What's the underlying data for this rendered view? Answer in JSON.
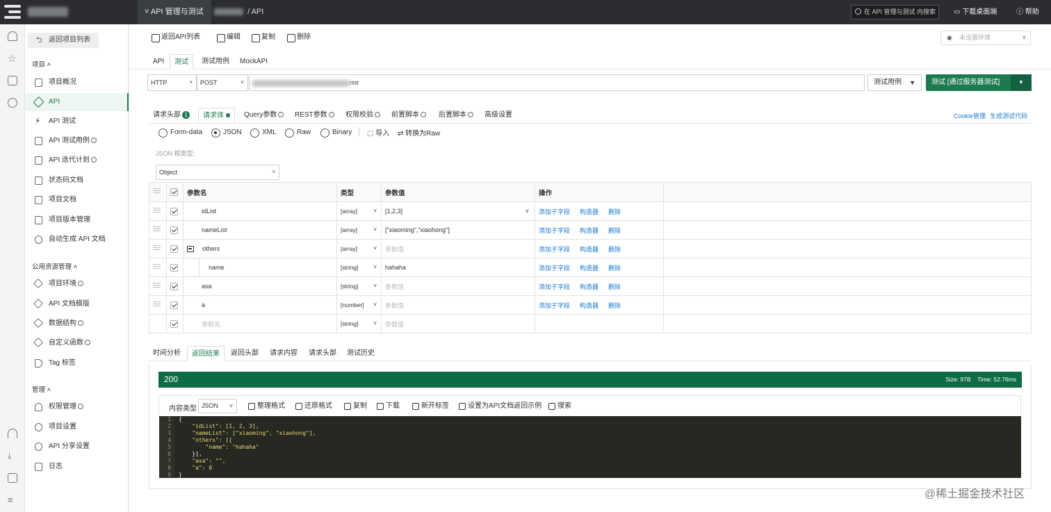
{
  "topbar": {
    "menu_label": "API 管理与测试",
    "crumb_tail": "/ API",
    "search_placeholder": "在 API 管理与测试 内搜索",
    "download_label": "下载桌面端",
    "help_label": "帮助"
  },
  "sidebar": {
    "back_label": "返回项目列表",
    "section_project": "项目 ˄",
    "project_items": [
      "项目概况",
      "API",
      "API 测试",
      "API 测试用例",
      "API 迭代计划",
      "状态码文档",
      "项目文档",
      "项目版本管理",
      "自动生成 API 文档"
    ],
    "section_public": "公用资源管理 ˄",
    "public_items": [
      "项目环境",
      "API 文档模版",
      "数据结构",
      "自定义函数",
      "Tag 标签"
    ],
    "section_manage": "管理 ˄",
    "manage_items": [
      "权限管理",
      "项目设置",
      "API 分享设置",
      "日志"
    ]
  },
  "toolbar": {
    "back_label": "返回API列表",
    "edit_label": "编辑",
    "copy_label": "复制",
    "delete_label": "删除",
    "env_placeholder": "未设置环境"
  },
  "main_tabs": [
    "API",
    "测试",
    "测试用例",
    "MockAPI"
  ],
  "request": {
    "protocol": "HTTP",
    "method": "POST",
    "url_suffix": "rint",
    "case_label": "测试用例",
    "send_label": "测试 [通过服务器测试]"
  },
  "req_tabs": {
    "headers": "请求头部",
    "headers_count": "1",
    "body": "请求体",
    "query": "Query参数",
    "rest": "REST参数",
    "auth": "权限校验",
    "pre": "前置脚本",
    "post": "后置脚本",
    "advanced": "高级设置",
    "cookie": "Cookie管理",
    "gen_code": "生成测试代码"
  },
  "body_types": [
    "Form-data",
    "JSON",
    "XML",
    "Raw",
    "Binary"
  ],
  "body_actions": {
    "import": "导入",
    "to_raw": "转换为Raw"
  },
  "json_root_label": "JSON 根类型:",
  "json_root_value": "Object",
  "params": {
    "headers": {
      "name": "参数名",
      "type": "类型",
      "value": "参数值",
      "ops": "操作"
    },
    "ops": {
      "add_child": "添加子字段",
      "builder": "构造器",
      "delete": "删除"
    },
    "value_placeholder": "参数值",
    "name_placeholder": "参数名",
    "rows": [
      {
        "name": "idList",
        "type": "[array]",
        "value": "[1,2,3]"
      },
      {
        "name": "nameList",
        "type": "[array]",
        "value": "[\"xiaoming\",\"xiaohong\"]"
      },
      {
        "name": "others",
        "type": "[array]",
        "value": ""
      },
      {
        "name": "name",
        "type": "[string]",
        "value": "hahaha"
      },
      {
        "name": "asa",
        "type": "[string]",
        "value": ""
      },
      {
        "name": "a",
        "type": "[number]",
        "value": ""
      },
      {
        "name": "",
        "type": "[string]",
        "value": ""
      }
    ]
  },
  "resp_tabs": [
    "时间分析",
    "返回结果",
    "返回头部",
    "请求内容",
    "请求头部",
    "测试历史"
  ],
  "response": {
    "status": "200",
    "size": "Size: 97B",
    "time": "Time: 52.76ms",
    "content_type_label": "内容类型",
    "content_type": "JSON",
    "tools": [
      "整理格式",
      "还原格式",
      "复制",
      "下载",
      "新开标签",
      "设置为API文档返回示例",
      "搜索"
    ]
  },
  "code_lines": [
    "{",
    "    \"idList\": [1, 2, 3],",
    "    \"nameList\": [\"xiaoming\", \"xiaohong\"],",
    "    \"others\": [{",
    "        \"name\": \"hahaha\"",
    "    }],",
    "    \"asa\": \"\",",
    "    \"a\": 0",
    "}"
  ],
  "watermark": "@稀土掘金技术社区"
}
